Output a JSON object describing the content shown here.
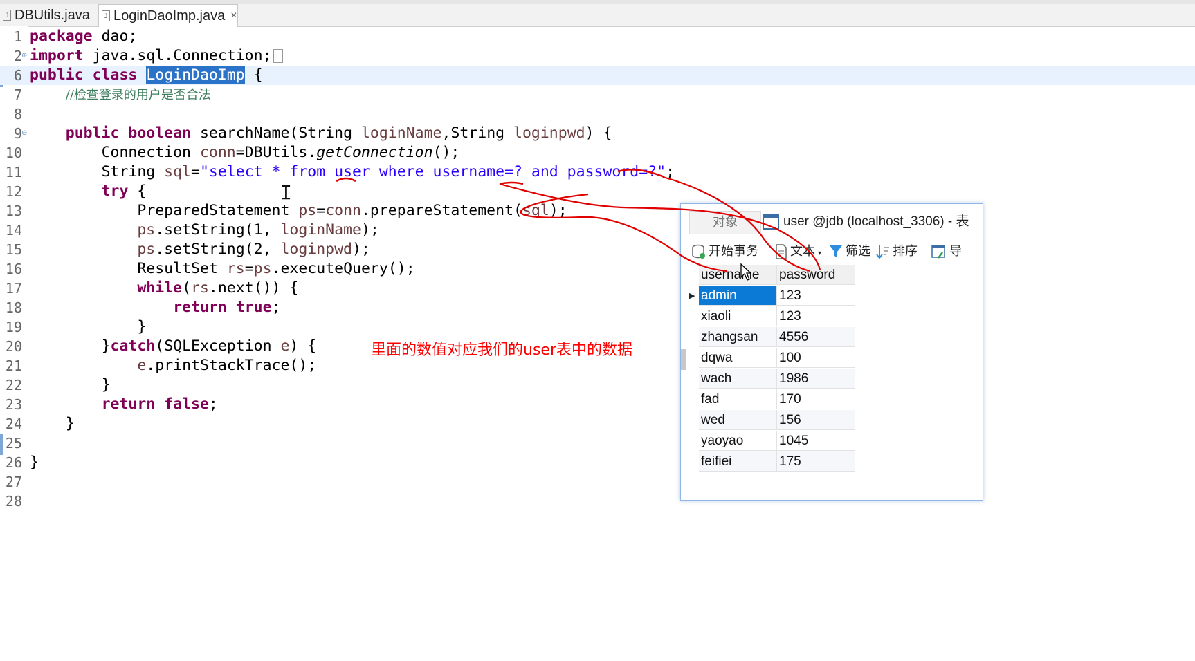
{
  "tabs": [
    {
      "label": "DBUtils.java",
      "active": false
    },
    {
      "label": "LoginDaoImp.java",
      "active": true,
      "close": "×"
    }
  ],
  "editor": {
    "lines": [
      {
        "n": "1"
      },
      {
        "n": "2"
      },
      {
        "n": "6"
      },
      {
        "n": "7"
      },
      {
        "n": "8"
      },
      {
        "n": "9"
      },
      {
        "n": "10"
      },
      {
        "n": "11"
      },
      {
        "n": "12"
      },
      {
        "n": "13"
      },
      {
        "n": "14"
      },
      {
        "n": "15"
      },
      {
        "n": "16"
      },
      {
        "n": "17"
      },
      {
        "n": "18"
      },
      {
        "n": "19"
      },
      {
        "n": "20"
      },
      {
        "n": "21"
      },
      {
        "n": "22"
      },
      {
        "n": "23"
      },
      {
        "n": "24"
      },
      {
        "n": "25"
      },
      {
        "n": "26"
      },
      {
        "n": "27"
      },
      {
        "n": "28"
      }
    ],
    "code": {
      "l1_kw": "package",
      "l1_rest": " dao;",
      "l2_kw": "import",
      "l2_rest": " java.sql.Connection;",
      "l6_kw1": "public",
      "l6_kw2": "class",
      "l6_sel": "LoginDaoImp",
      "l6_rest": " {",
      "l7_comment": "//检查登录的用户是否合法",
      "l9_kw1": "public",
      "l9_kw2": "boolean",
      "l9_m": " searchName(String ",
      "l9_p1": "loginName",
      "l9_m2": ",String ",
      "l9_p2": "loginpwd",
      "l9_end": ") {",
      "l10_a": "Connection ",
      "l10_v": "conn",
      "l10_b": "=DBUtils.",
      "l10_i": "getConnection",
      "l10_c": "();",
      "l11_a": "String ",
      "l11_v": "sql",
      "l11_b": "=",
      "l11_s": "\"select * from user where username=? and password=?\"",
      "l11_c": ";",
      "l12_kw": "try",
      "l12_rest": " {",
      "l13_a": "PreparedStatement ",
      "l13_v": "ps",
      "l13_b": "=",
      "l13_v2": "conn",
      "l13_c": ".prepareStatement(",
      "l13_v3": "sql",
      "l13_d": ");",
      "l14_v": "ps",
      "l14_a": ".setString(1, ",
      "l14_p": "loginName",
      "l14_b": ");",
      "l15_v": "ps",
      "l15_a": ".setString(2, ",
      "l15_p": "loginpwd",
      "l15_b": ");",
      "l16_a": "ResultSet ",
      "l16_v": "rs",
      "l16_b": "=",
      "l16_v2": "ps",
      "l16_c": ".executeQuery();",
      "l17_kw": "while",
      "l17_a": "(",
      "l17_v": "rs",
      "l17_b": ".next()) {",
      "l18_kw1": "return",
      "l18_kw2": "true",
      "l18_b": ";",
      "l19": "}",
      "l20_a": "}",
      "l20_kw": "catch",
      "l20_b": "(SQLException ",
      "l20_v": "e",
      "l20_c": ") {",
      "l21_v": "e",
      "l21_a": ".printStackTrace();",
      "l22": "}",
      "l23_kw1": "return",
      "l23_kw2": "false",
      "l23_b": ";",
      "l24": "}",
      "l26": "}"
    }
  },
  "annotation": "里面的数值对应我们的user表中的数据",
  "db_window": {
    "tab_objects": "对象",
    "tab_table": "user @jdb (localhost_3306) - 表",
    "toolbar": {
      "begin_tx": "开始事务",
      "text": "文本",
      "filter": "筛选",
      "sort": "排序",
      "export": "导"
    },
    "columns": [
      "username",
      "password"
    ],
    "rows": [
      [
        "admin",
        "123"
      ],
      [
        "xiaoli",
        "123"
      ],
      [
        "zhangsan",
        "4556"
      ],
      [
        "dqwa",
        "100"
      ],
      [
        "wach",
        "1986"
      ],
      [
        "fad",
        "170"
      ],
      [
        "wed",
        "156"
      ],
      [
        "yaoyao",
        "1045"
      ],
      [
        "feifiei",
        "175"
      ]
    ],
    "selected_row": 0
  },
  "colors": {
    "keyword": "#7f0055",
    "string": "#2a00ff",
    "variable": "#6a3e3e",
    "comment": "#3f7f5f",
    "annotation_ink": "#ff0000",
    "selection": "#0a7ad6"
  }
}
